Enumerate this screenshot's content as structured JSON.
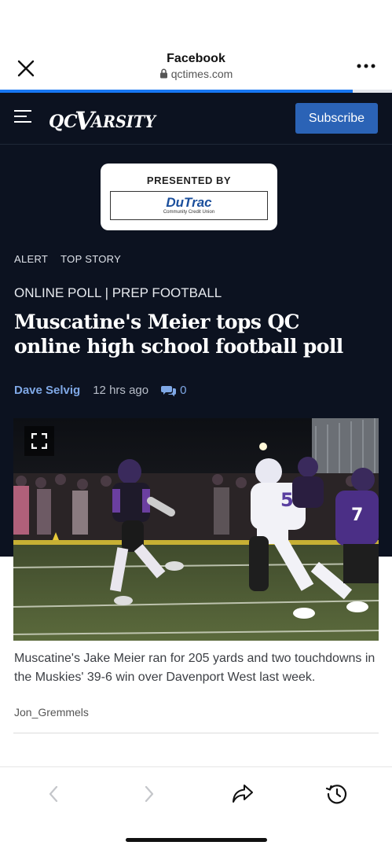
{
  "browser": {
    "title": "Facebook",
    "url": "qctimes.com",
    "progress": 0.9
  },
  "site": {
    "logo": "QC VARSITY",
    "subscribe_label": "Subscribe",
    "sponsor": {
      "label": "PRESENTED BY",
      "name": "DuTrac",
      "subtitle": "Community Credit Union"
    },
    "tags": [
      "ALERT",
      "TOP STORY"
    ]
  },
  "article": {
    "kicker": "ONLINE POLL | PREP FOOTBALL",
    "headline": "Muscatine's Meier tops QC online high school football poll",
    "author": "Dave Selvig",
    "time": "12 hrs ago",
    "comment_count": "0",
    "caption": "Muscatine's Jake Meier ran for 205 yards and two touchdowns in the Muskies' 39-6 win over Davenport West last week.",
    "photo_credit": "Jon_Gremmels"
  },
  "colors": {
    "site_bg": "#0c1220",
    "accent": "#2b63b6",
    "link": "#7fa8e6",
    "progress": "#1877f2"
  }
}
